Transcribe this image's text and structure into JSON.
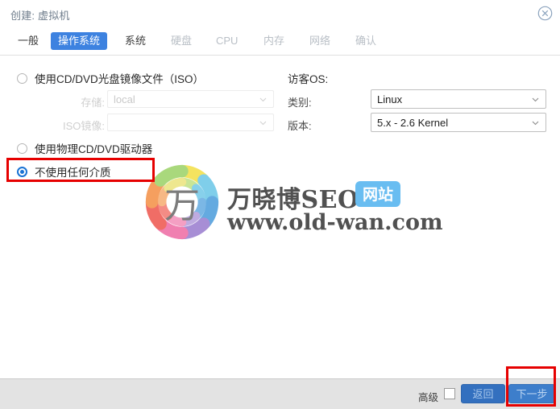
{
  "window": {
    "title": "创建: 虚拟机",
    "close_icon": "close-circle-icon"
  },
  "tabs": [
    {
      "label": "一般",
      "state": "normal"
    },
    {
      "label": "操作系统",
      "state": "active"
    },
    {
      "label": "系统",
      "state": "normal"
    },
    {
      "label": "硬盘",
      "state": "dim"
    },
    {
      "label": "CPU",
      "state": "dim"
    },
    {
      "label": "内存",
      "state": "dim"
    },
    {
      "label": "网络",
      "state": "dim"
    },
    {
      "label": "确认",
      "state": "dim"
    }
  ],
  "media": {
    "option_iso": "使用CD/DVD光盘镜像文件（ISO）",
    "option_physical": "使用物理CD/DVD驱动器",
    "option_none": "不使用任何介质",
    "storage_label": "存储:",
    "storage_value": "local",
    "iso_label": "ISO镜像:",
    "iso_value": ""
  },
  "guest_os": {
    "section_label": "访客OS:",
    "type_label": "类别:",
    "type_value": "Linux",
    "version_label": "版本:",
    "version_value": "5.x - 2.6 Kernel"
  },
  "footer": {
    "advanced_label": "高级",
    "back_label": "返回",
    "next_label": "下一步"
  },
  "watermark": {
    "logo_char": "万",
    "title": "万晓博SEO",
    "badge": "网站",
    "url": "www.old-wan.com"
  },
  "colors": {
    "accent_blue": "#3d82e0",
    "button_blue": "#3370bf",
    "annotation_red": "#e60000",
    "radio_checked": "#1a73d4",
    "footer_bg": "#e3e3e3"
  }
}
